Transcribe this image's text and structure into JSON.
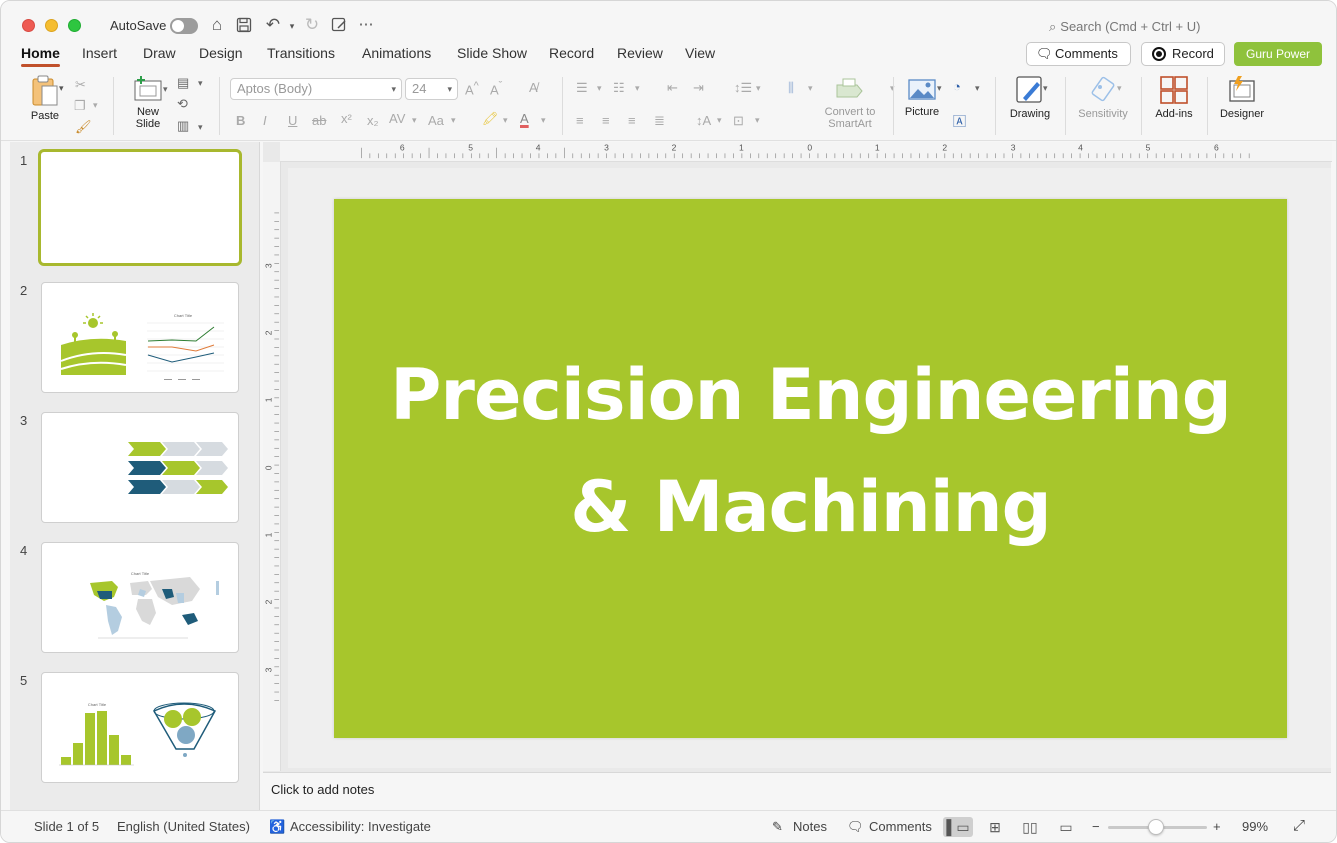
{
  "app": {
    "autosave_label": "AutoSave",
    "search_placeholder": "Search (Cmd + Ctrl + U)",
    "accent_color": "#c0502b",
    "brand_button_color": "#8fc23c"
  },
  "tabs": [
    "Home",
    "Insert",
    "Draw",
    "Design",
    "Transitions",
    "Animations",
    "Slide Show",
    "Record",
    "Review",
    "View"
  ],
  "header_buttons": {
    "comments": "Comments",
    "record": "Record",
    "guru": "Guru Power"
  },
  "ribbon": {
    "paste": "Paste",
    "new_slide_line1": "New",
    "new_slide_line2": "Slide",
    "font_name": "Aptos (Body)",
    "font_size": "24",
    "convert_line1": "Convert to",
    "convert_line2": "SmartArt",
    "picture": "Picture",
    "drawing": "Drawing",
    "sensitivity": "Sensitivity",
    "addins": "Add-ins",
    "designer": "Designer"
  },
  "ruler": {
    "h_ticks": [
      "6",
      "5",
      "4",
      "3",
      "2",
      "1",
      "0",
      "1",
      "2",
      "3",
      "4",
      "5",
      "6"
    ],
    "v_ticks": [
      "3",
      "2",
      "1",
      "0",
      "1",
      "2",
      "3"
    ]
  },
  "slides": {
    "numbers": [
      "1",
      "2",
      "3",
      "4",
      "5"
    ],
    "thumb2_chart_title": "Chart Title",
    "thumb4_chart_title": "Chart Title",
    "thumb5_chart_title": "Chart Title"
  },
  "current_slide": {
    "title_line1": "Precision Engineering",
    "title_line2": "& Machining",
    "background_color": "#a7c62c"
  },
  "notes_placeholder": "Click to add notes",
  "status": {
    "slide_of": "Slide 1 of 5",
    "language": "English (United States)",
    "accessibility": "Accessibility: Investigate",
    "notes": "Notes",
    "comments": "Comments",
    "zoom": "99%"
  }
}
